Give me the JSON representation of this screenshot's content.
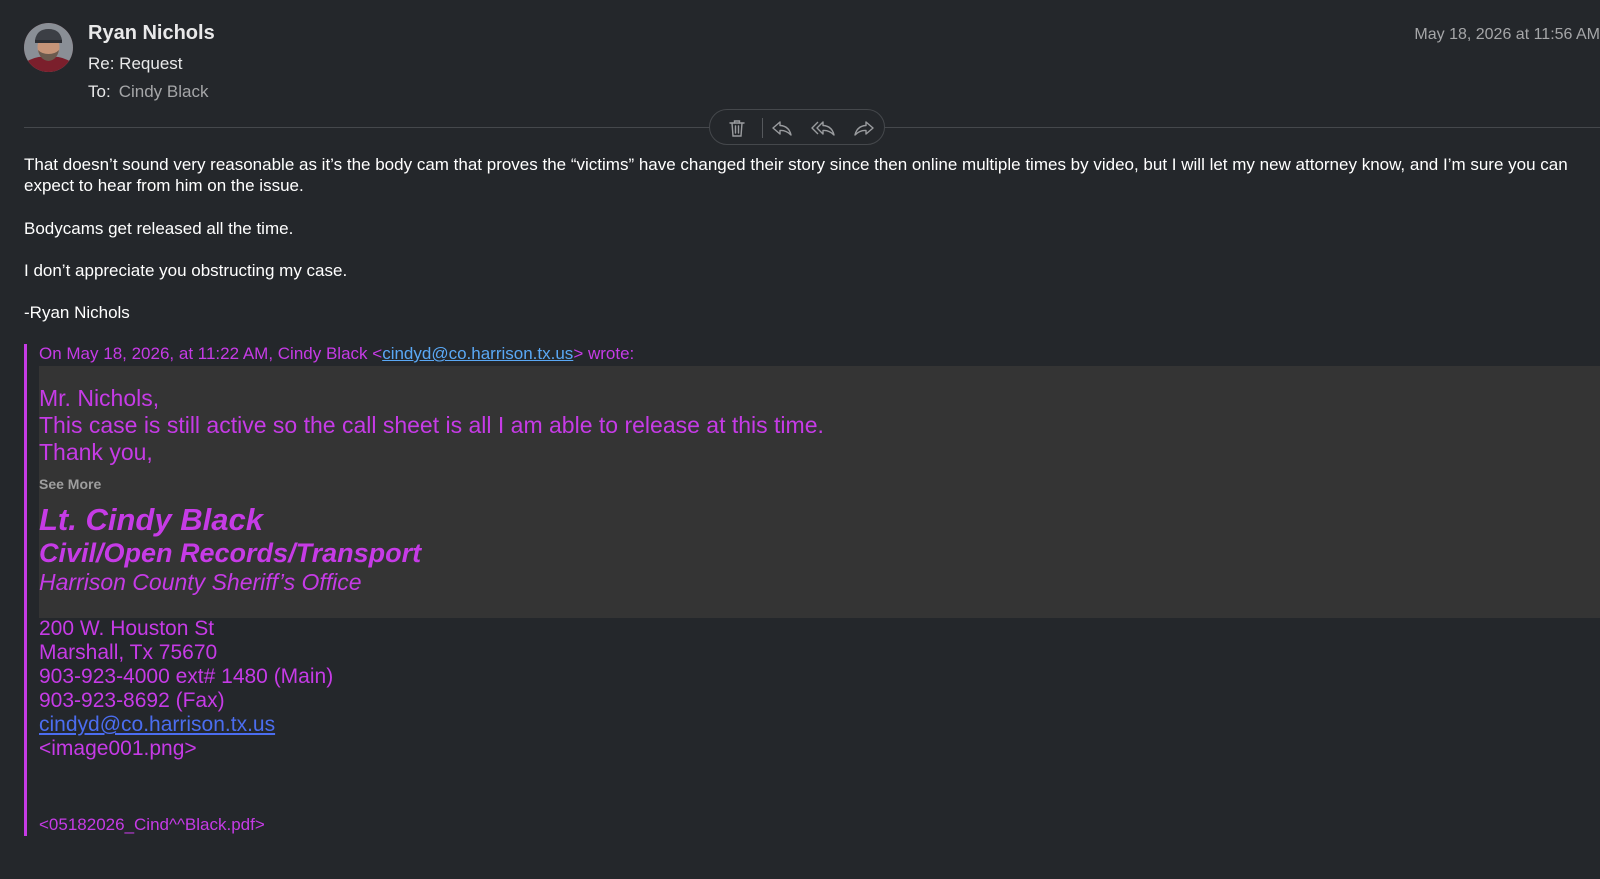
{
  "header": {
    "sender": "Ryan Nichols",
    "subject": "Re: Request",
    "to_label": "To:",
    "to_value": "Cindy Black",
    "date": "May 18, 2026 at 11:56 AM"
  },
  "toolbar": {
    "icons": [
      "trash-icon",
      "reply-icon",
      "reply-all-icon",
      "forward-icon"
    ]
  },
  "body": {
    "p1": "That doesn’t sound very reasonable as it’s the body cam that proves the “victims” have changed their story since then online multiple times by video, but I will let my new attorney know, and I’m sure you can expect to hear from him on the issue.",
    "p2": "Bodycams get released all the time.",
    "p3": "I don’t appreciate you obstructing my case.",
    "p4": "-Ryan Nichols"
  },
  "quote": {
    "header_prefix": "On May 18, 2026, at 11:22 AM, Cindy Black <",
    "header_email": "cindyd@co.harrison.tx.us",
    "header_suffix": "> wrote:",
    "greeting": "Mr. Nichols,",
    "line1": "This case is still active so the call sheet is all I am able to release at this time.",
    "line2": "Thank you,",
    "see_more": "See More",
    "sig_name": "Lt. Cindy Black",
    "sig_title": "Civil/Open Records/Transport",
    "sig_office": "Harrison County Sheriff’s Office",
    "address1": "200 W. Houston St",
    "address2": "Marshall, Tx 75670",
    "phone_main": "903-923-4000 ext# 1480  (Main)",
    "phone_fax": "903-923-8692 (Fax)",
    "email": "cindyd@co.harrison.tx.us",
    "image_placeholder": "<image001.png>",
    "attachment": "<05182026_Cind^^Black.pdf>"
  },
  "colors": {
    "background": "#24272b",
    "quote_accent": "#c63be6",
    "quote_box": "#343434",
    "link_blue": "#5aa8f5",
    "email_link": "#4b6df0"
  }
}
